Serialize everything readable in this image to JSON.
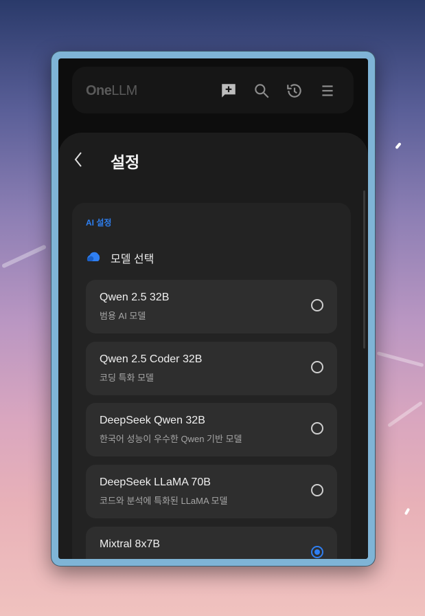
{
  "app": {
    "logo_one": "One",
    "logo_llm": "LLM",
    "icons": [
      "new-chat-icon",
      "search-icon",
      "history-icon",
      "menu-icon"
    ]
  },
  "settings": {
    "title": "설정",
    "section_label": "AI 설정",
    "model_select_label": "모델 선택",
    "accent_color": "#2e7ff0",
    "options": [
      {
        "name": "Qwen 2.5 32B",
        "desc": "범용 AI 모델",
        "selected": false
      },
      {
        "name": "Qwen 2.5 Coder 32B",
        "desc": "코딩 특화 모델",
        "selected": false
      },
      {
        "name": "DeepSeek Qwen 32B",
        "desc": "한국어 성능이 우수한 Qwen 기반 모델",
        "selected": false
      },
      {
        "name": "DeepSeek LLaMA 70B",
        "desc": "코드와 분석에 특화된 LLaMA 모델",
        "selected": false
      },
      {
        "name": "Mixtral 8x7B",
        "desc": "",
        "selected": true
      }
    ]
  }
}
